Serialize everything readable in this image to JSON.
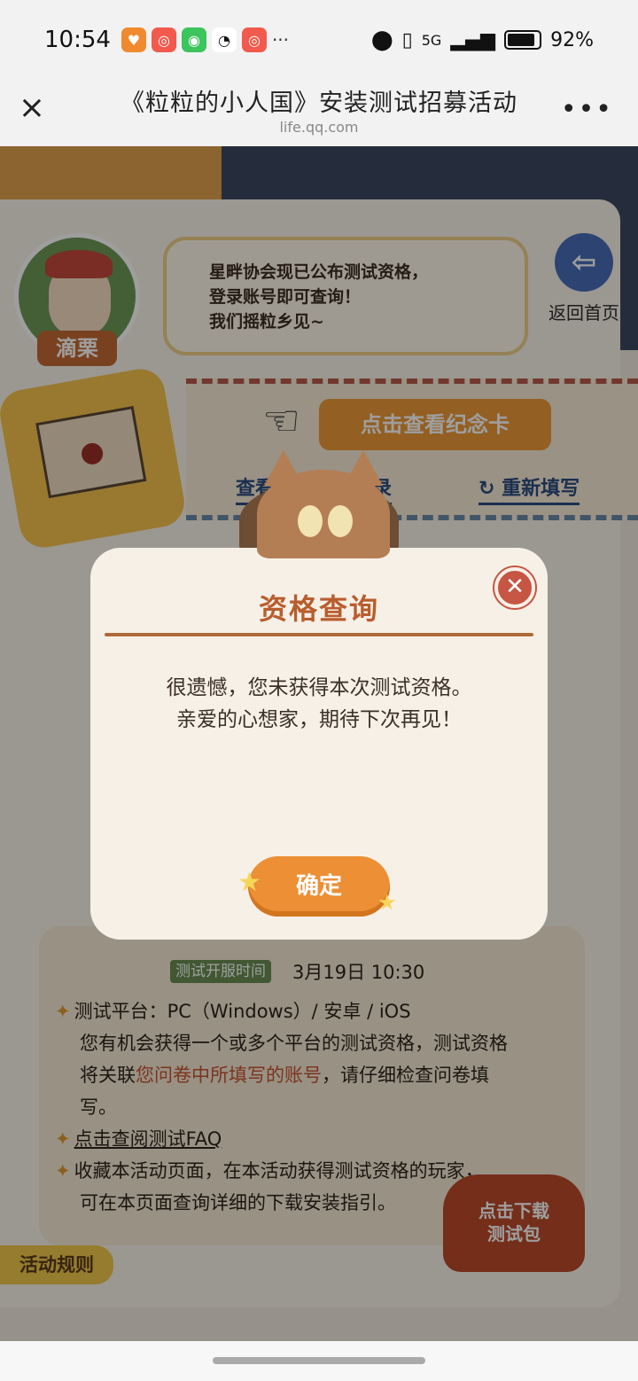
{
  "status_bar": {
    "time": "10:54",
    "battery": "92%",
    "network": "5G",
    "more": "···"
  },
  "title_bar": {
    "title": "《粒粒的小人国》安装测试招募活动",
    "url": "life.qq.com",
    "close_icon": "×",
    "more_icon": "•••"
  },
  "page": {
    "character_name": "滴栗",
    "speech": [
      "星畔协会现已公布测试资格，",
      "登录账号即可查询！",
      "我们摇粒乡见~"
    ],
    "back_home": "返回首页",
    "view_card": "点击查看纪念卡",
    "view_records": "查看问卷填写记录",
    "refill": "重新填写",
    "test_time_badge": "测试开服时间",
    "test_time": "3月19日  10:30",
    "rules": [
      "测试平台：PC（Windows）/ 安卓 / iOS",
      "您有机会获得一个或多个平台的测试资格，测试资格",
      "将关联",
      "您问卷中所填写的账号",
      "，请仔细检查问卷填",
      "写。",
      "点击查阅测试FAQ",
      "收藏本活动页面，在本活动获得测试资格的玩家，",
      "可在本页面查询详细的下载安装指引。"
    ],
    "rules_tab": "活动规则",
    "download_badge": [
      "点击下载",
      "测试包"
    ]
  },
  "dialog": {
    "title": "资格查询",
    "line1": "很遗憾，您未获得本次测试资格。",
    "line2": "亲爱的心想家，期待下次再见！",
    "confirm": "确定",
    "close_icon": "✕"
  },
  "colors": {
    "accent": "#ec8f35",
    "title": "#b85d2e",
    "close": "#c65543"
  }
}
